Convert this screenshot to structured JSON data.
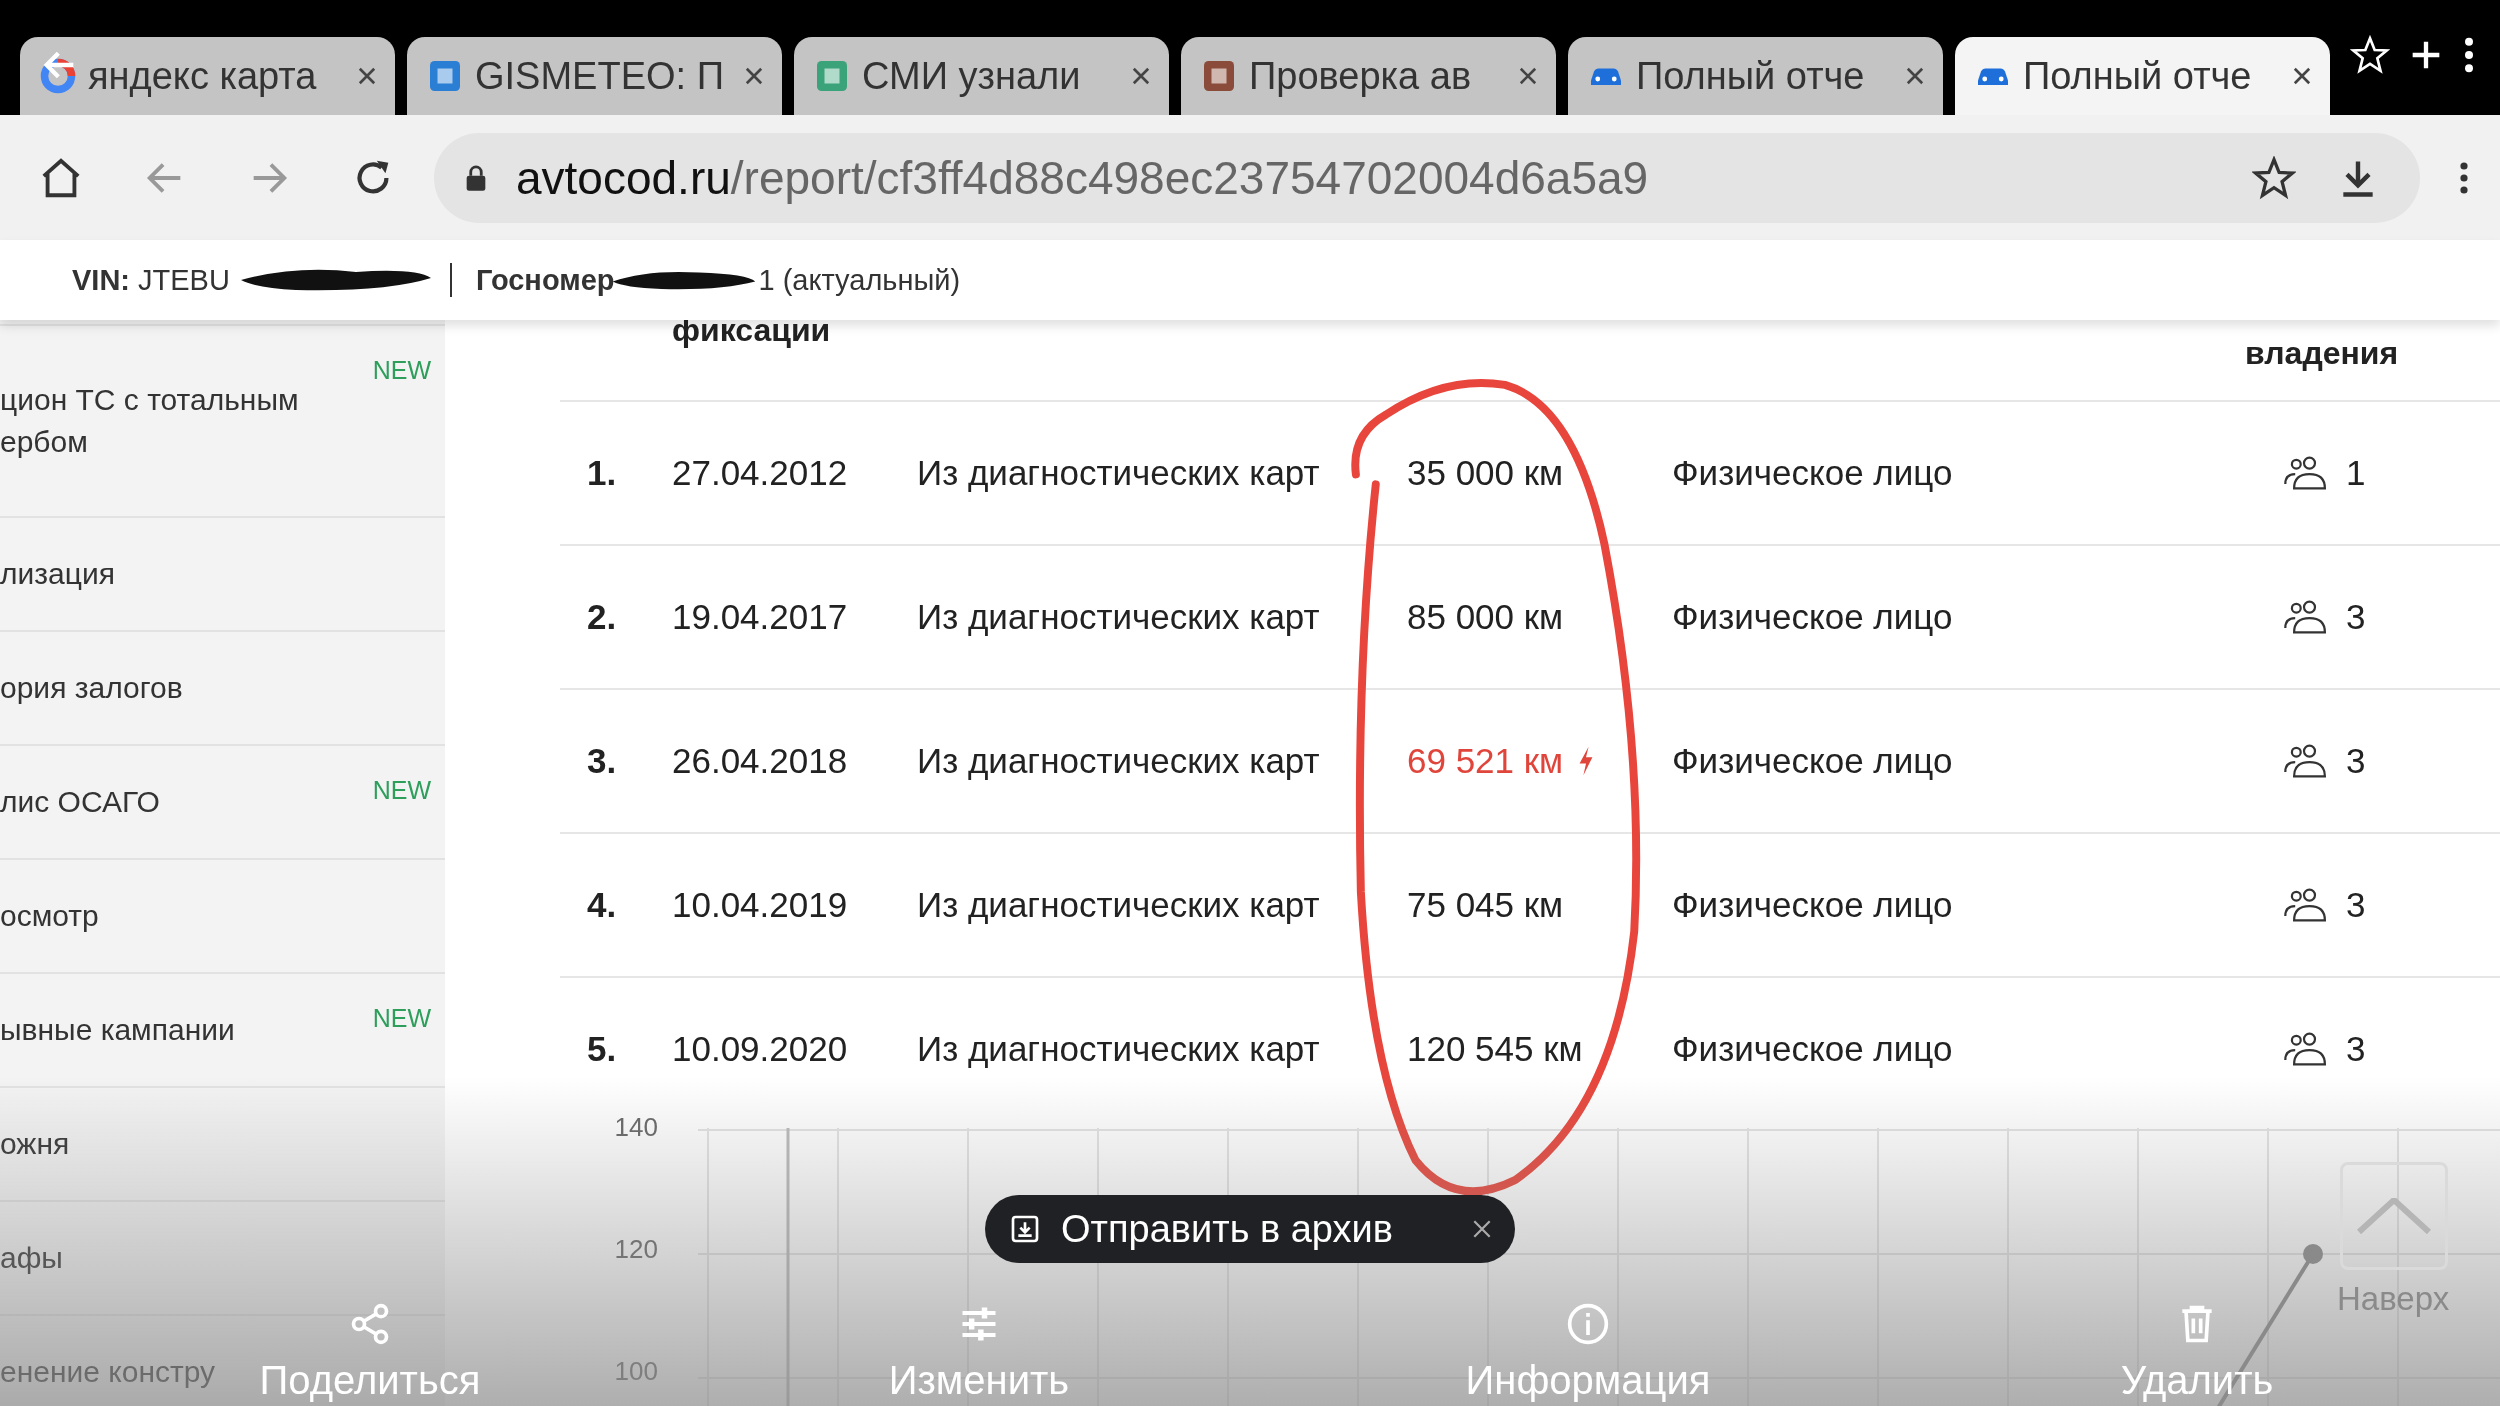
{
  "browser": {
    "tabs": [
      {
        "title": "яндекс карта",
        "kind": "google",
        "color": "#4285f4",
        "selected": false
      },
      {
        "title": "GISMETEO: П",
        "kind": "square",
        "color": "#2a7fd4",
        "selected": false
      },
      {
        "title": "СМИ узнали",
        "kind": "square",
        "color": "#3aa37a",
        "selected": false
      },
      {
        "title": "Проверка ав",
        "kind": "square",
        "color": "#8a4b3a",
        "selected": false
      },
      {
        "title": "Полный отче",
        "kind": "car",
        "color": "#1e6fd9",
        "selected": false
      },
      {
        "title": "Полный отче",
        "kind": "car",
        "color": "#1e6fd9",
        "selected": true
      }
    ],
    "url_host": "avtocod.ru",
    "url_path": "/report/cf3ff4d88c498ec23754702004d6a5a9"
  },
  "report_header": {
    "vin_label": "VIN:",
    "vin_value": "JTEBU",
    "plate_label": "Госномер",
    "plate_value": "1 (актуальный)"
  },
  "sidebar": {
    "items": [
      {
        "label": "цион ТС с тотальным ербом",
        "badge": "NEW"
      },
      {
        "label": "лизация"
      },
      {
        "label": "ория залогов"
      },
      {
        "label": "лис ОСАГО",
        "badge": "NEW"
      },
      {
        "label": "осмотр"
      },
      {
        "label": "ывные кампании",
        "badge": "NEW"
      },
      {
        "label": "ожня"
      },
      {
        "label": "афы"
      },
      {
        "label": "енение констру"
      }
    ]
  },
  "table": {
    "columns": [
      {
        "label": "фиксации"
      },
      {
        "label": "владения"
      }
    ],
    "rows": [
      {
        "num": "1.",
        "date": "27.04.2012",
        "source": "Из диагностических карт",
        "mileage": "35 000 км",
        "warning": false,
        "owner": "Физическое лицо",
        "owners": "1"
      },
      {
        "num": "2.",
        "date": "19.04.2017",
        "source": "Из диагностических карт",
        "mileage": "85 000 км",
        "warning": false,
        "owner": "Физическое лицо",
        "owners": "3"
      },
      {
        "num": "3.",
        "date": "26.04.2018",
        "source": "Из диагностических карт",
        "mileage": "69 521 км",
        "warning": true,
        "owner": "Физическое лицо",
        "owners": "3"
      },
      {
        "num": "4.",
        "date": "10.04.2019",
        "source": "Из диагностических карт",
        "mileage": "75 045 км",
        "warning": false,
        "owner": "Физическое лицо",
        "owners": "3"
      },
      {
        "num": "5.",
        "date": "10.09.2020",
        "source": "Из диагностических карт",
        "mileage": "120 545 км",
        "warning": false,
        "owner": "Физическое лицо",
        "owners": "3"
      }
    ]
  },
  "chart": {
    "y_labels": [
      "140",
      "120",
      "100"
    ]
  },
  "scroll_top": {
    "label": "Наверх"
  },
  "toast": {
    "label": "Отправить в архив"
  },
  "gallery_actions": [
    {
      "label": "Поделиться",
      "kind": "share"
    },
    {
      "label": "Изменить",
      "kind": "edit"
    },
    {
      "label": "Информация",
      "kind": "info"
    },
    {
      "label": "Удалить",
      "kind": "delete"
    }
  ]
}
